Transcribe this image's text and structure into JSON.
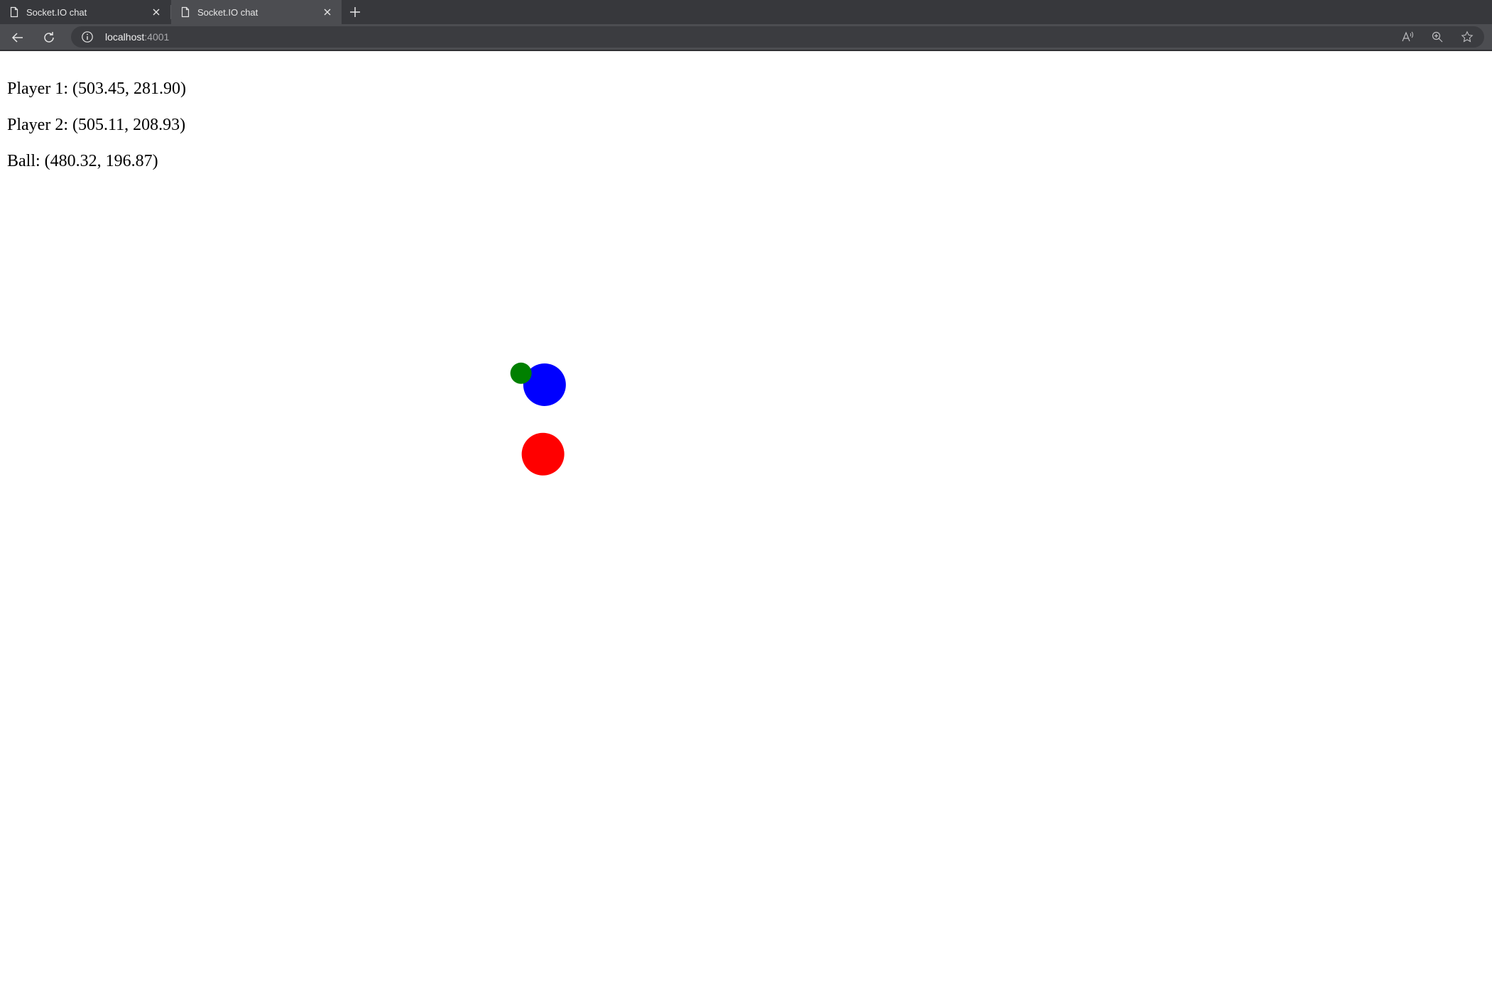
{
  "tabs": [
    {
      "title": "Socket.IO chat",
      "active": false
    },
    {
      "title": "Socket.IO chat",
      "active": true
    }
  ],
  "address_bar": {
    "host": "localhost",
    "port": ":4001"
  },
  "page": {
    "player1_label": "Player 1: (503.45, 281.90)",
    "player2_label": "Player 2: (505.11, 208.93)",
    "ball_label": "Ball: (480.32, 196.87)"
  },
  "game": {
    "player1": {
      "x": 503.45,
      "y": 281.9,
      "color": "#ff0000"
    },
    "player2": {
      "x": 505.11,
      "y": 208.93,
      "color": "#0000ff"
    },
    "ball": {
      "x": 480.32,
      "y": 196.87,
      "color": "#008000"
    }
  },
  "colors": {
    "tabstrip": "#37383c",
    "toolbar": "#4c4d51"
  }
}
